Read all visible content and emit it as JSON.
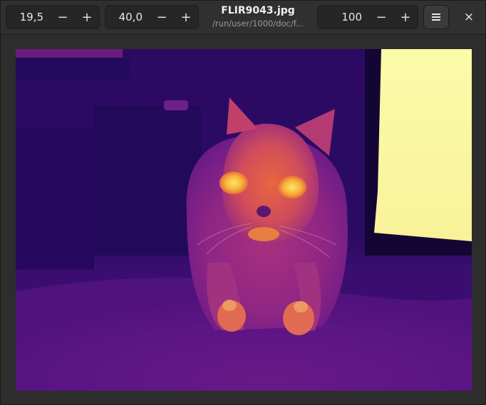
{
  "headerbar": {
    "spin_min": {
      "value": "19,5",
      "minus": "−",
      "plus": "+"
    },
    "spin_max": {
      "value": "40,0",
      "minus": "−",
      "plus": "+"
    },
    "title": "FLIR9043.jpg",
    "subtitle": "/run/user/1000/doc/f...",
    "spin_zoom": {
      "value": "100",
      "minus": "−",
      "plus": "+"
    },
    "menu_icon": "hamburger-menu-icon",
    "close_label": "×"
  },
  "image": {
    "description_icon": "thermal-image",
    "palette": {
      "cold": "#2a0a66",
      "mid": "#b3308a",
      "warm": "#f08a3c",
      "hot": "#fbfba8"
    }
  }
}
